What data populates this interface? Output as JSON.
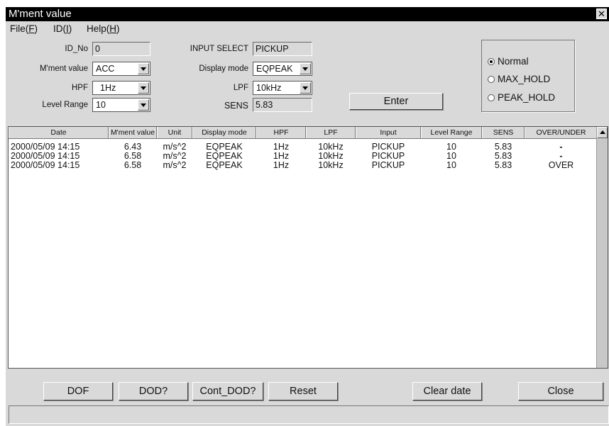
{
  "window": {
    "title": "M'ment value",
    "close_glyph": "✕"
  },
  "menu": [
    {
      "label": "File(",
      "key": "F",
      "suffix": ")"
    },
    {
      "label": "ID(",
      "key": "I",
      "suffix": ")"
    },
    {
      "label": "Help(",
      "key": "H",
      "suffix": ")"
    }
  ],
  "form": {
    "id_no": {
      "label": "ID_No",
      "value": "0"
    },
    "mment_value": {
      "label": "M'ment value",
      "value": "ACC"
    },
    "hpf": {
      "label": "HPF",
      "value": "1Hz"
    },
    "level_range": {
      "label": "Level Range",
      "value": "10"
    },
    "input_select": {
      "label": "INPUT SELECT",
      "value": "PICKUP"
    },
    "display_mode": {
      "label": "Display mode",
      "value": "EQPEAK"
    },
    "lpf": {
      "label": "LPF",
      "value": "10kHz"
    },
    "sens": {
      "label": "SENS",
      "value": "5.83"
    },
    "enter_label": "Enter"
  },
  "radio": {
    "selected": "Normal",
    "options": [
      "Normal",
      "MAX_HOLD",
      "PEAK_HOLD"
    ]
  },
  "table": {
    "columns": [
      "Date",
      "M'ment value",
      "Unit",
      "Display mode",
      "HPF",
      "LPF",
      "Input",
      "Level Range",
      "SENS",
      "OVER/UNDER"
    ],
    "rows": [
      [
        "2000/05/09  14:15",
        "6.43",
        "m/s^2",
        "EQPEAK",
        "1Hz",
        "10kHz",
        "PICKUP",
        "10",
        "5.83",
        "-"
      ],
      [
        "2000/05/09  14:15",
        "6.58",
        "m/s^2",
        "EQPEAK",
        "1Hz",
        "10kHz",
        "PICKUP",
        "10",
        "5.83",
        "-"
      ],
      [
        "2000/05/09  14:15",
        "6.58",
        "m/s^2",
        "EQPEAK",
        "1Hz",
        "10kHz",
        "PICKUP",
        "10",
        "5.83",
        "OVER"
      ]
    ]
  },
  "buttons": {
    "dof": "DOF",
    "dod": "DOD?",
    "cont_dod": "Cont_DOD?",
    "reset": "Reset",
    "clear_date": "Clear date",
    "close": "Close"
  },
  "status_text": ""
}
